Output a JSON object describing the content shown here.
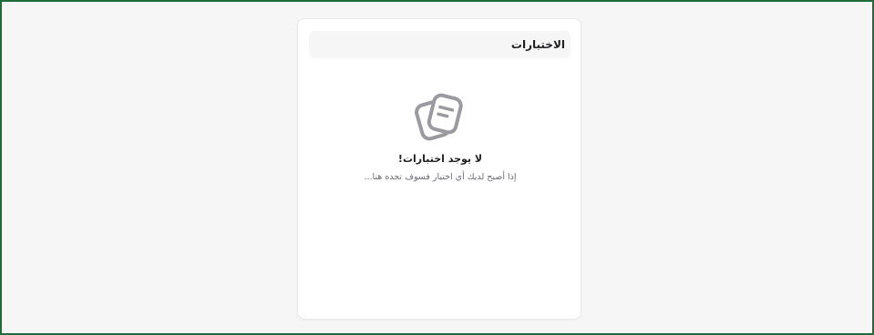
{
  "panel": {
    "title": "الاختبارات"
  },
  "empty_state": {
    "icon": "document-stack-icon",
    "title": "لا يوجد اختبارات!",
    "description": "إذا أصبح لديك أي اختبار فسوف تجده هنا..."
  },
  "colors": {
    "frame_border": "#1f6b3a",
    "page_background": "#f6f6f7",
    "card_background": "#ffffff",
    "icon_stroke": "#9a9a9f"
  }
}
